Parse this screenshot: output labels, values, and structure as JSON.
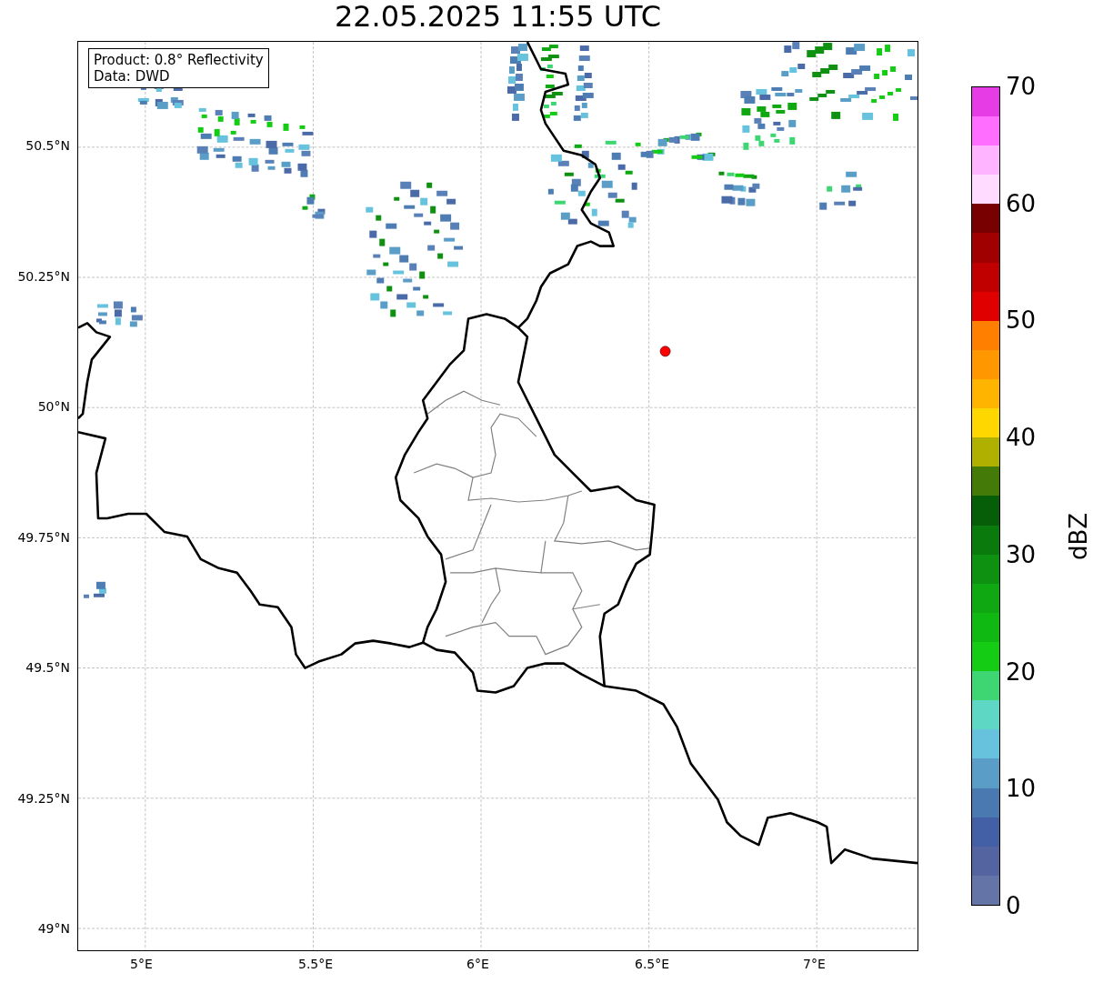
{
  "title": "22.05.2025 11:55 UTC",
  "info_box": [
    "Product: 0.8° Reflectivity",
    "Data: DWD"
  ],
  "lat_ticks": [
    "50.5°N",
    "50.25°N",
    "50°N",
    "49.75°N",
    "49.5°N",
    "49.25°N",
    "49°N"
  ],
  "lon_ticks": [
    "5°E",
    "5.5°E",
    "6°E",
    "6.5°E",
    "7°E"
  ],
  "colorbar": {
    "label": "dBZ",
    "ticks": [
      "70",
      "60",
      "50",
      "40",
      "30",
      "20",
      "10",
      "0"
    ],
    "bands": [
      {
        "color": "#6474a6"
      },
      {
        "color": "#5464a0"
      },
      {
        "color": "#435fa5"
      },
      {
        "color": "#4a78b0"
      },
      {
        "color": "#5a9ec8"
      },
      {
        "color": "#66c2dd"
      },
      {
        "color": "#5ed8c4"
      },
      {
        "color": "#3dd672"
      },
      {
        "color": "#14cc14"
      },
      {
        "color": "#10b812"
      },
      {
        "color": "#10a812"
      },
      {
        "color": "#0e9010"
      },
      {
        "color": "#0a7a0c"
      },
      {
        "color": "#075e08"
      },
      {
        "color": "#447a08"
      },
      {
        "color": "#b0b000"
      },
      {
        "color": "#ffd700"
      },
      {
        "color": "#ffb400"
      },
      {
        "color": "#ff9800"
      },
      {
        "color": "#ff7f00"
      },
      {
        "color": "#e00000"
      },
      {
        "color": "#c00000"
      },
      {
        "color": "#a00000"
      },
      {
        "color": "#780000"
      },
      {
        "color": "#ffdcff"
      },
      {
        "color": "#ffb4ff"
      },
      {
        "color": "#ff6eff"
      },
      {
        "color": "#e63ce6"
      }
    ]
  }
}
